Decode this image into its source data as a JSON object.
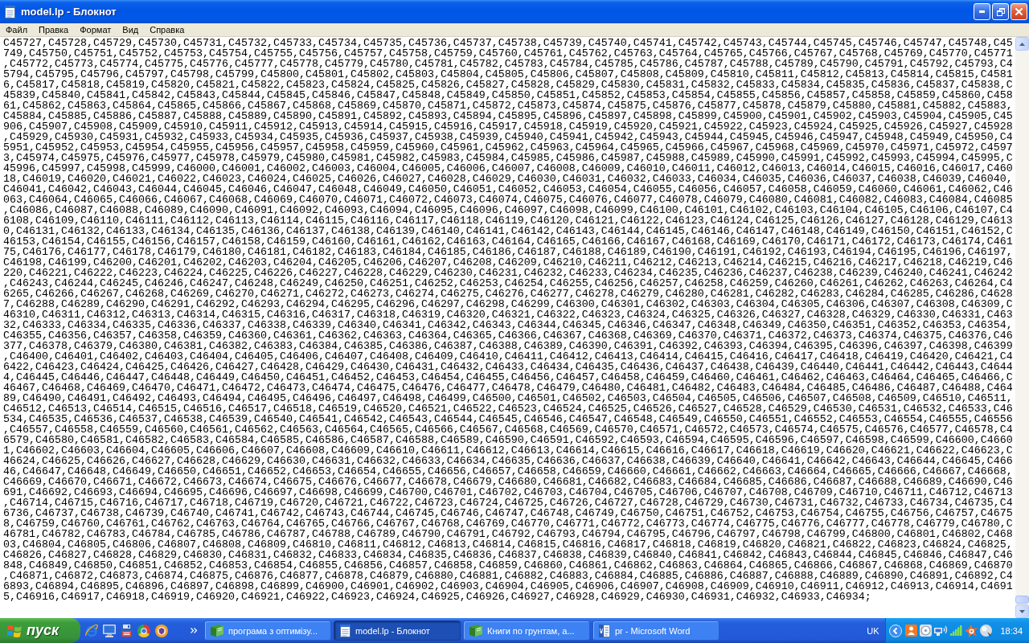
{
  "window": {
    "title": "model.lp - Блокнот",
    "maximized": true
  },
  "menu": [
    "Файл",
    "Правка",
    "Формат",
    "Вид",
    "Справка"
  ],
  "document": {
    "text": "C45727,C45728,C45729,C45730,C45731,C45732,C45733,C45734,C45735,C45736,C45737,C45738,C45739,C45740,C45741,C45742,C45743,C45744,C45745,C45746,C45747,C45748,C45749,C45750,C45751,C45752,C45753,C45754,C45755,C45756,C45757,C45758,C45759,C45760,C45761,C45762,C45763,C45764,C45765,C45766,C45767,C45768,C45769,C45770,C45771,C45772,C45773,C45774,C45775,C45776,C45777,C45778,C45779,C45780,C45781,C45782,C45783,C45784,C45785,C45786,C45787,C45788,C45789,C45790,C45791,C45792,C45793,C45794,C45795,C45796,C45797,C45798,C45799,C45800,C45801,C45802,C45803,C45804,C45805,C45806,C45807,C45808,C45809,C45810,C45811,C45812,C45813,C45814,C45815,C45816,C45817,C45818,C45819,C45820,C45821,C45822,C45823,C45824,C45825,C45826,C45827,C45828,C45829,C45830,C45831,C45832,C45833,C45834,C45835,C45836,C45837,C45838,C45839,C45840,C45841,C45842,C45843,C45844,C45845,C45846,C45847,C45848,C45849,C45850,C45851,C45852,C45853,C45854,C45855,C45856,C45857,C45858,C45859,C45860,C45861,C45862,C45863,C45864,C45865,C45866,C45867,C45868,C45869,C45870,C45871,C45872,C45873,C45874,C45875,C45876,C45877,C45878,C45879,C45880,C45881,C45882,C45883,C45884,C45885,C45886,C45887,C45888,C45889,C45890,C45891,C45892,C45893,C45894,C45895,C45896,C45897,C45898,C45899,C45900,C45901,C45902,C45903,C45904,C45905,C45906,C45907,C45908,C45909,C45910,C45911,C45912,C45913,C45914,C45915,C45916,C45917,C45918,C45919,C45920,C45921,C45922,C45923,C45924,C45925,C45926,C45927,C45928,C45929,C45930,C45931,C45932,C45933,C45934,C45935,C45936,C45937,C45938,C45939,C45940,C45941,C45942,C45943,C45944,C45945,C45946,C45947,C45948,C45949,C45950,C45951,C45952,C45953,C45954,C45955,C45956,C45957,C45958,C45959,C45960,C45961,C45962,C45963,C45964,C45965,C45966,C45967,C45968,C45969,C45970,C45971,C45972,C45973,C45974,C45975,C45976,C45977,C45978,C45979,C45980,C45981,C45982,C45983,C45984,C45985,C45986,C45987,C45988,C45989,C45990,C45991,C45992,C45993,C45994,C45995,C45996,C45997,C45998,C45999,C46000,C46001,C46002,C46003,C46004,C46005,C46006,C46007,C46008,C46009,C46010,C46011,C46012,C46013,C46014,C46015,C46016,C46017,C46018,C46019,C46020,C46021,C46022,C46023,C46024,C46025,C46026,C46027,C46028,C46029,C46030,C46031,C46032,C46033,C46034,C46035,C46036,C46037,C46038,C46039,C46040,C46041,C46042,C46043,C46044,C46045,C46046,C46047,C46048,C46049,C46050,C46051,C46052,C46053,C46054,C46055,C46056,C46057,C46058,C46059,C46060,C46061,C46062,C46063,C46064,C46065,C46066,C46067,C46068,C46069,C46070,C46071,C46072,C46073,C46074,C46075,C46076,C46077,C46078,C46079,C46080,C46081,C46082,C46083,C46084,C46085,C46086,C46087,C46088,C46089,C46090,C46091,C46092,C46093,C46094,C46095,C46096,C46097,C46098,C46099,C46100,C46101,C46102,C46103,C46104,C46105,C46106,C46107,C46108,C46109,C46110,C46111,C46112,C46113,C46114,C46115,C46116,C46117,C46118,C46119,C46120,C46121,C46122,C46123,C46124,C46125,C46126,C46127,C46128,C46129,C46130,C46131,C46132,C46133,C46134,C46135,C46136,C46137,C46138,C46139,C46140,C46141,C46142,C46143,C46144,C46145,C46146,C46147,C46148,C46149,C46150,C46151,C46152,C46153,C46154,C46155,C46156,C46157,C46158,C46159,C46160,C46161,C46162,C46163,C46164,C46165,C46166,C46167,C46168,C46169,C46170,C46171,C46172,C46173,C46174,C46175,C46176,C46177,C46178,C46179,C46180,C46181,C46182,C46183,C46184,C46185,C46186,C46187,C46188,C46189,C46190,C46191,C46192,C46193,C46194,C46195,C46196,C46197,C46198,C46199,C46200,C46201,C46202,C46203,C46204,C46205,C46206,C46207,C46208,C46209,C46210,C46211,C46212,C46213,C46214,C46215,C46216,C46217,C46218,C46219,C46220,C46221,C46222,C46223,C46224,C46225,C46226,C46227,C46228,C46229,C46230,C46231,C46232,C46233,C46234,C46235,C46236,C46237,C46238,C46239,C46240,C46241,C46242,C46243,C46244,C46245,C46246,C46247,C46248,C46249,C46250,C46251,C46252,C46253,C46254,C46255,C46256,C46257,C46258,C46259,C46260,C46261,C46262,C46263,C46264,C46265,C46266,C46267,C46268,C46269,C46270,C46271,C46272,C46273,C46274,C46275,C46276,C46277,C46278,C46279,C46280,C46281,C46282,C46283,C46284,C46285,C46286,C46287,C46288,C46289,C46290,C46291,C46292,C46293,C46294,C46295,C46296,C46297,C46298,C46299,C46300,C46301,C46302,C46303,C46304,C46305,C46306,C46307,C46308,C46309,C46310,C46311,C46312,C46313,C46314,C46315,C46316,C46317,C46318,C46319,C46320,C46321,C46322,C46323,C46324,C46325,C46326,C46327,C46328,C46329,C46330,C46331,C46332,C46333,C46334,C46335,C46336,C46337,C46338,C46339,C46340,C46341,C46342,C46343,C46344,C46345,C46346,C46347,C46348,C46349,C46350,C46351,C46352,C46353,C46354,C46355,C46356,C46357,C46358,C46359,C46360,C46361,C46362,C46363,C46364,C46365,C46366,C46367,C46368,C46369,C46370,C46371,C46372,C46373,C46374,C46375,C46376,C46377,C46378,C46379,C46380,C46381,C46382,C46383,C46384,C46385,C46386,C46387,C46388,C46389,C46390,C46391,C46392,C46393,C46394,C46395,C46396,C46397,C46398,C46399,C46400,C46401,C46402,C46403,C46404,C46405,C46406,C46407,C46408,C46409,C46410,C46411,C46412,C46413,C46414,C46415,C46416,C46417,C46418,C46419,C46420,C46421,C46422,C46423,C46424,C46425,C46426,C46427,C46428,C46429,C46430,C46431,C46432,C46433,C46434,C46435,C46436,C46437,C46438,C46439,C46440,C46441,C46442,C46443,C46444,C46445,C46446,C46447,C46448,C46449,C46450,C46451,C46452,C46453,C46454,C46455,C46456,C46457,C46458,C46459,C46460,C46461,C46462,C46463,C46464,C46465,C46466,C46467,C46468,C46469,C46470,C46471,C46472,C46473,C46474,C46475,C46476,C46477,C46478,C46479,C46480,C46481,C46482,C46483,C46484,C46485,C46486,C46487,C46488,C46489,C46490,C46491,C46492,C46493,C46494,C46495,C46496,C46497,C46498,C46499,C46500,C46501,C46502,C46503,C46504,C46505,C46506,C46507,C46508,C46509,C46510,C46511,C46512,C46513,C46514,C46515,C46516,C46517,C46518,C46519,C46520,C46521,C46522,C46523,C46524,C46525,C46526,C46527,C46528,C46529,C46530,C46531,C46532,C46533,C46534,C46535,C46536,C46537,C46538,C46539,C46540,C46541,C46542,C46543,C46544,C46545,C46546,C46547,C46548,C46549,C46550,C46551,C46552,C46553,C46554,C46555,C46556,C46557,C46558,C46559,C46560,C46561,C46562,C46563,C46564,C46565,C46566,C46567,C46568,C46569,C46570,C46571,C46572,C46573,C46574,C46575,C46576,C46577,C46578,C46579,C46580,C46581,C46582,C46583,C46584,C46585,C46586,C46587,C46588,C46589,C46590,C46591,C46592,C46593,C46594,C46595,C46596,C46597,C46598,C46599,C46600,C46601,C46602,C46603,C46604,C46605,C46606,C46607,C46608,C46609,C46610,C46611,C46612,C46613,C46614,C46615,C46616,C46617,C46618,C46619,C46620,C46621,C46622,C46623,C46624,C46625,C46626,C46627,C46628,C46629,C46630,C46631,C46632,C46633,C46634,C46635,C46636,C46637,C46638,C46639,C46640,C46641,C46642,C46643,C46644,C46645,C46646,C46647,C46648,C46649,C46650,C46651,C46652,C46653,C46654,C46655,C46656,C46657,C46658,C46659,C46660,C46661,C46662,C46663,C46664,C46665,C46666,C46667,C46668,C46669,C46670,C46671,C46672,C46673,C46674,C46675,C46676,C46677,C46678,C46679,C46680,C46681,C46682,C46683,C46684,C46685,C46686,C46687,C46688,C46689,C46690,C46691,C46692,C46693,C46694,C46695,C46696,C46697,C46698,C46699,C46700,C46701,C46702,C46703,C46704,C46705,C46706,C46707,C46708,C46709,C46710,C46711,C46712,C46713,C46714,C46715,C46716,C46717,C46718,C46719,C46720,C46721,C46722,C46723,C46724,C46725,C46726,C46727,C46728,C46729,C46730,C46731,C46732,C46733,C46734,C46735,C46736,C46737,C46738,C46739,C46740,C46741,C46742,C46743,C46744,C46745,C46746,C46747,C46748,C46749,C46750,C46751,C46752,C46753,C46754,C46755,C46756,C46757,C46758,C46759,C46760,C46761,C46762,C46763,C46764,C46765,C46766,C46767,C46768,C46769,C46770,C46771,C46772,C46773,C46774,C46775,C46776,C46777,C46778,C46779,C46780,C46781,C46782,C46783,C46784,C46785,C46786,C46787,C46788,C46789,C46790,C46791,C46792,C46793,C46794,C46795,C46796,C46797,C46798,C46799,C46800,C46801,C46802,C46803,C46804,C46805,C46806,C46807,C46808,C46809,C46810,C46811,C46812,C46813,C46814,C46815,C46816,C46817,C46818,C46819,C46820,C46821,C46822,C46823,C46824,C46825,C46826,C46827,C46828,C46829,C46830,C46831,C46832,C46833,C46834,C46835,C46836,C46837,C46838,C46839,C46840,C46841,C46842,C46843,C46844,C46845,C46846,C46847,C46848,C46849,C46850,C46851,C46852,C46853,C46854,C46855,C46856,C46857,C46858,C46859,C46860,C46861,C46862,C46863,C46864,C46865,C46866,C46867,C46868,C46869,C46870,C46871,C46872,C46873,C46874,C46875,C46876,C46877,C46878,C46879,C46880,C46881,C46882,C46883,C46884,C46885,C46886,C46887,C46888,C46889,C46890,C46891,C46892,C46893,C46894,C46895,C46896,C46897,C46898,C46899,C46900,C46901,C46902,C46903,C46904,C46905,C46906,C46907,C46908,C46909,C46910,C46911,C46912,C46913,C46914,C46915,C46916,C46917,C46918,C46919,C46920,C46921,C46922,C46923,C46924,C46925,C46926,C46927,C46928,C46929,C46930,C46931,C46932,C46933,C46934;"
  },
  "taskbar": {
    "start_label": "пуск",
    "tasks": [
      {
        "label": "програма з оптимізу...",
        "kind": "book",
        "selected": false
      },
      {
        "label": "model.lp - Блокнот",
        "kind": "notepad",
        "selected": true
      },
      {
        "label": "Книги по грунтам, а...",
        "kind": "book",
        "selected": false
      },
      {
        "label": "pr - Microsoft Word",
        "kind": "word",
        "selected": false
      }
    ],
    "language": "UK",
    "clock": "18:34"
  }
}
